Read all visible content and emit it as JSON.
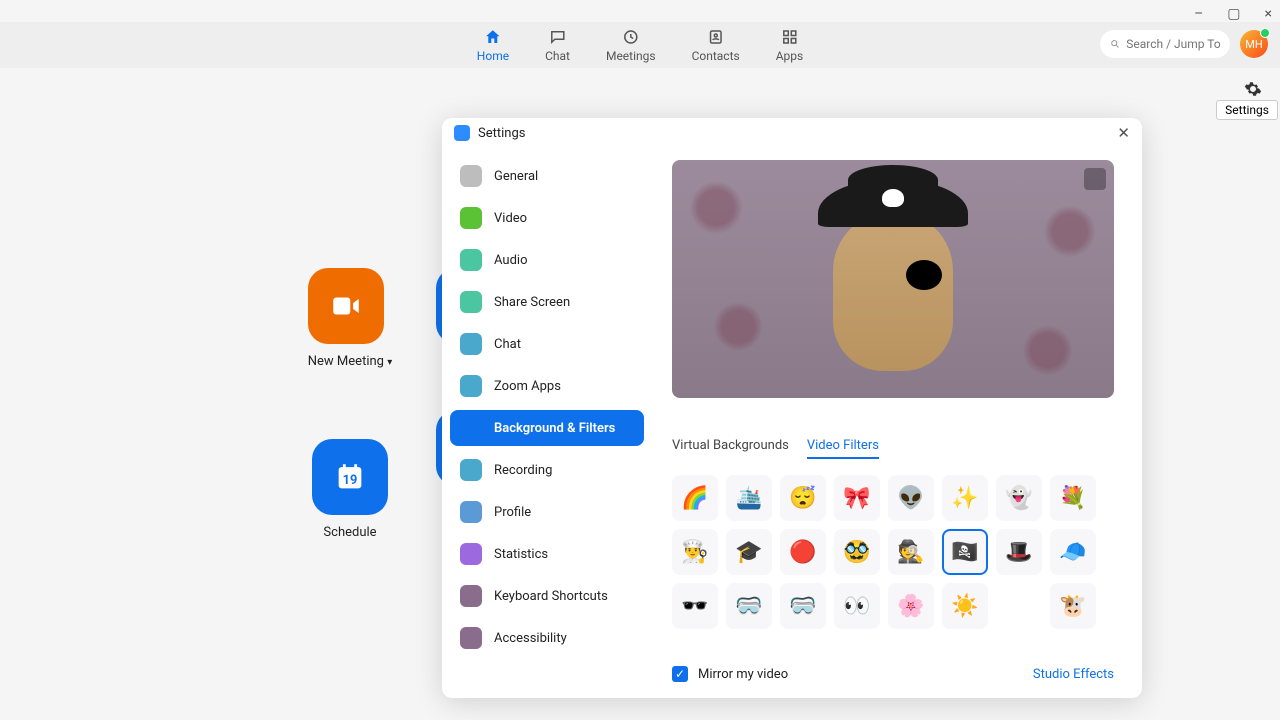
{
  "window": {
    "minimize": "–",
    "maximize": "▢",
    "close": "×"
  },
  "nav": {
    "items": [
      {
        "label": "Home",
        "active": true
      },
      {
        "label": "Chat"
      },
      {
        "label": "Meetings"
      },
      {
        "label": "Contacts"
      },
      {
        "label": "Apps"
      }
    ]
  },
  "search": {
    "placeholder": "Search / Jump To"
  },
  "avatar": {
    "initials": "MH"
  },
  "gear_tooltip": "Settings",
  "home": {
    "new_meeting": "New Meeting",
    "schedule": "Schedule",
    "schedule_day": "19"
  },
  "settings": {
    "title": "Settings",
    "sidebar": [
      {
        "label": "General",
        "ic": "ic-general"
      },
      {
        "label": "Video",
        "ic": "ic-video"
      },
      {
        "label": "Audio",
        "ic": "ic-audio"
      },
      {
        "label": "Share Screen",
        "ic": "ic-share"
      },
      {
        "label": "Chat",
        "ic": "ic-chat"
      },
      {
        "label": "Zoom Apps",
        "ic": "ic-apps"
      },
      {
        "label": "Background & Filters",
        "ic": "ic-bgf",
        "selected": true
      },
      {
        "label": "Recording",
        "ic": "ic-rec"
      },
      {
        "label": "Profile",
        "ic": "ic-profile"
      },
      {
        "label": "Statistics",
        "ic": "ic-stats"
      },
      {
        "label": "Keyboard Shortcuts",
        "ic": "ic-keys"
      },
      {
        "label": "Accessibility",
        "ic": "ic-acc"
      }
    ],
    "tabs": [
      {
        "label": "Virtual Backgrounds"
      },
      {
        "label": "Video Filters",
        "active": true
      }
    ],
    "filters": [
      "color-swirl",
      "submarine",
      "sleepy-zzz",
      "red-bow",
      "antennae",
      "sparkle",
      "ghost",
      "flower-hat",
      "chef-hat",
      "graduation",
      "red-beret",
      "mustache-glasses",
      "spy-hat",
      "pirate",
      "black-hat",
      "grey-cap",
      "3d-glasses",
      "vr-headset",
      "ski-goggles",
      "big-eyes",
      "flower-crown",
      "sun",
      "",
      "cow"
    ],
    "selected_filter_index": 13,
    "mirror_label": "Mirror my video",
    "mirror_checked": true,
    "studio": "Studio Effects"
  }
}
